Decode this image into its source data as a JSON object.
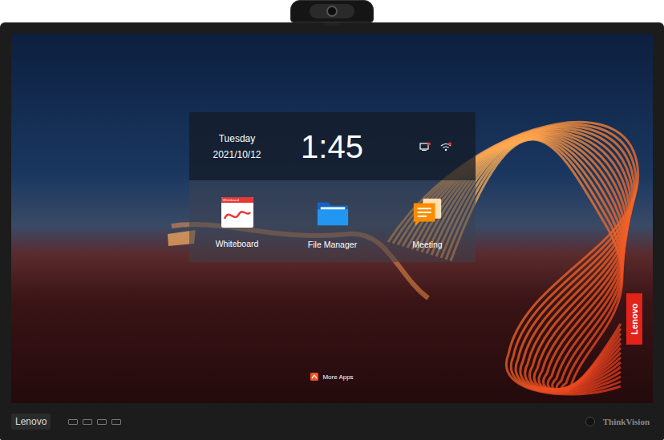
{
  "status_panel": {
    "day": "Tuesday",
    "date": "2021/10/12",
    "time": "1:45"
  },
  "apps": [
    {
      "label": "Whiteboard",
      "icon_text": "Whiteboard"
    },
    {
      "label": "File Manager"
    },
    {
      "label": "Meeting"
    }
  ],
  "more_apps": "More Apps",
  "badge": "Lenovo",
  "bezel": {
    "brand": "Lenovo",
    "model": "ThinkVision"
  }
}
